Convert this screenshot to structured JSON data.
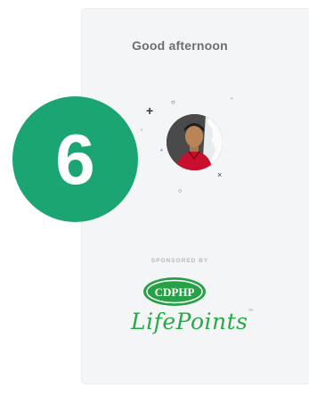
{
  "card": {
    "greeting": "Good afternoon"
  },
  "sponsor": {
    "label": "SPONSORED BY",
    "brand_primary": "CDPHP",
    "brand_secondary": "LifePoints",
    "brand_mark": "™"
  },
  "badge": {
    "step_number": "6"
  },
  "colors": {
    "badge_green": "#1aa573",
    "lifepoints_green": "#2aa848",
    "cdphp_green": "#27a047",
    "card_bg": "#f4f5f6",
    "greeting_text": "#6b6f74"
  },
  "icons": {
    "avatar": "user-avatar-icon",
    "decorations": [
      "plus-icon",
      "circle-icon",
      "dot-icon",
      "x-icon"
    ]
  }
}
